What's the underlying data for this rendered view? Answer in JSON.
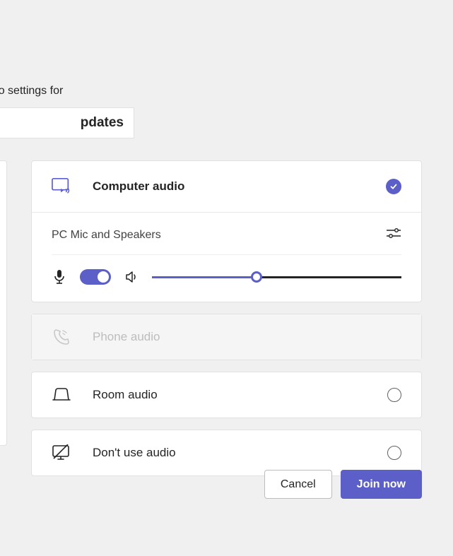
{
  "header": {
    "prompt_fragment": "d video settings for",
    "meeting_name_fragment": "pdates"
  },
  "audio": {
    "computer": {
      "label": "Computer audio",
      "selected": true
    },
    "device": {
      "name": "PC Mic and Speakers"
    },
    "mic_on": true,
    "volume_percent": 42,
    "phone": {
      "label": "Phone audio",
      "enabled": false
    },
    "room": {
      "label": "Room audio"
    },
    "none": {
      "label": "Don't use audio"
    }
  },
  "footer": {
    "cancel": "Cancel",
    "join": "Join now"
  }
}
